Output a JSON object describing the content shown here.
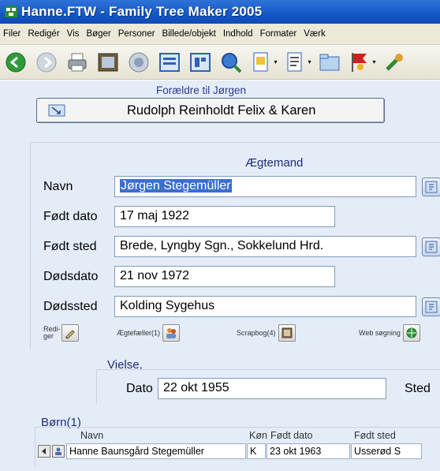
{
  "window": {
    "title": "Hanne.FTW - Family Tree Maker 2005"
  },
  "menu": [
    "Filer",
    "Redigér",
    "Vis",
    "Bøger",
    "Personer",
    "Billede/objekt",
    "Indhold",
    "Formater",
    "Værk"
  ],
  "toolbar": {
    "icons": [
      "back-icon",
      "forward-icon",
      "print-icon",
      "family-view-icon",
      "pedigree-icon",
      "individual-view-icon",
      "outline-view-icon",
      "search-icon",
      "document-icon",
      "report-icon",
      "folder-icon",
      "flag-icon",
      "tool-icon"
    ]
  },
  "parents": {
    "label": "Forældre til Jørgen",
    "button_text": "Rudolph Reinholdt Felix & Karen"
  },
  "spouse": {
    "section_title": "Ægtemand",
    "fields": {
      "name_label": "Navn",
      "name_value": "Jørgen Stegemüller",
      "birth_date_label": "Født dato",
      "birth_date_value": "17 maj 1922",
      "birth_place_label": "Født sted",
      "birth_place_value": "Brede, Lyngby Sgn., Sokkelund Hrd.",
      "death_date_label": "Dødsdato",
      "death_date_value": "21 nov 1972",
      "death_place_label": "Dødssted",
      "death_place_value": "Kolding Sygehus"
    },
    "tools": {
      "edit_label": "Redi- ger",
      "spouses_label": "Ægtefæller(1)",
      "scrapbook_label": "Scrapbog(4)",
      "web_search_label": "Web søgning"
    }
  },
  "marriage": {
    "title": "Vielse,",
    "date_label": "Dato",
    "date_value": "22 okt 1955",
    "place_label": "Sted"
  },
  "children": {
    "title": "Børn(1)",
    "columns": [
      "Navn",
      "Køn",
      "Født dato",
      "Født sted"
    ],
    "rows": [
      {
        "name": "Hanne Baunsgård Stegemüller",
        "sex": "K",
        "birth_date": "23 okt 1963",
        "birth_place": "Usserød S"
      }
    ]
  },
  "colors": {
    "title_bar": "#1557c6",
    "panel_bg": "#e4ecf7",
    "selection": "#3a6fd0",
    "heading_text": "#1e2d77"
  }
}
